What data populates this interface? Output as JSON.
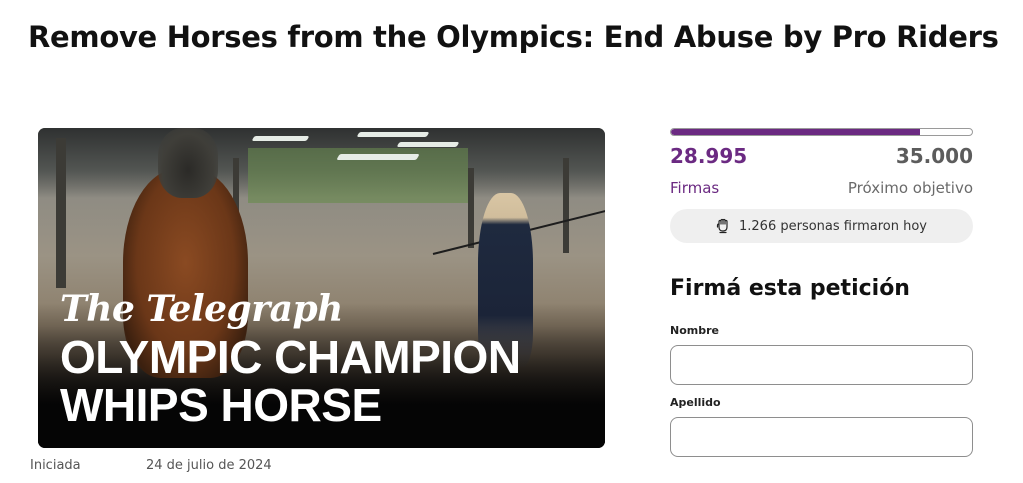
{
  "petition": {
    "title": "Remove Horses from the Olympics: End Abuse by Pro Riders",
    "started_label": "Iniciada",
    "started_date": "24 de julio de 2024"
  },
  "media": {
    "brand": "The Telegraph",
    "headline_line1": "OLYMPIC CHAMPION",
    "headline_line2": "WHIPS HORSE"
  },
  "stats": {
    "signatures": "28.995",
    "signatures_label": "Firmas",
    "goal": "35.000",
    "goal_label": "Próximo objetivo",
    "progress_fraction": 0.8284,
    "today_text": "1.266 personas firmaron hoy",
    "today_icon": "fist-icon"
  },
  "form": {
    "title": "Firmá esta petición",
    "first_name_label": "Nombre",
    "first_name_value": "",
    "last_name_label": "Apellido",
    "last_name_value": ""
  },
  "colors": {
    "accent": "#6b2a82",
    "muted": "#5c5c5c",
    "pill_bg": "#efefef"
  }
}
